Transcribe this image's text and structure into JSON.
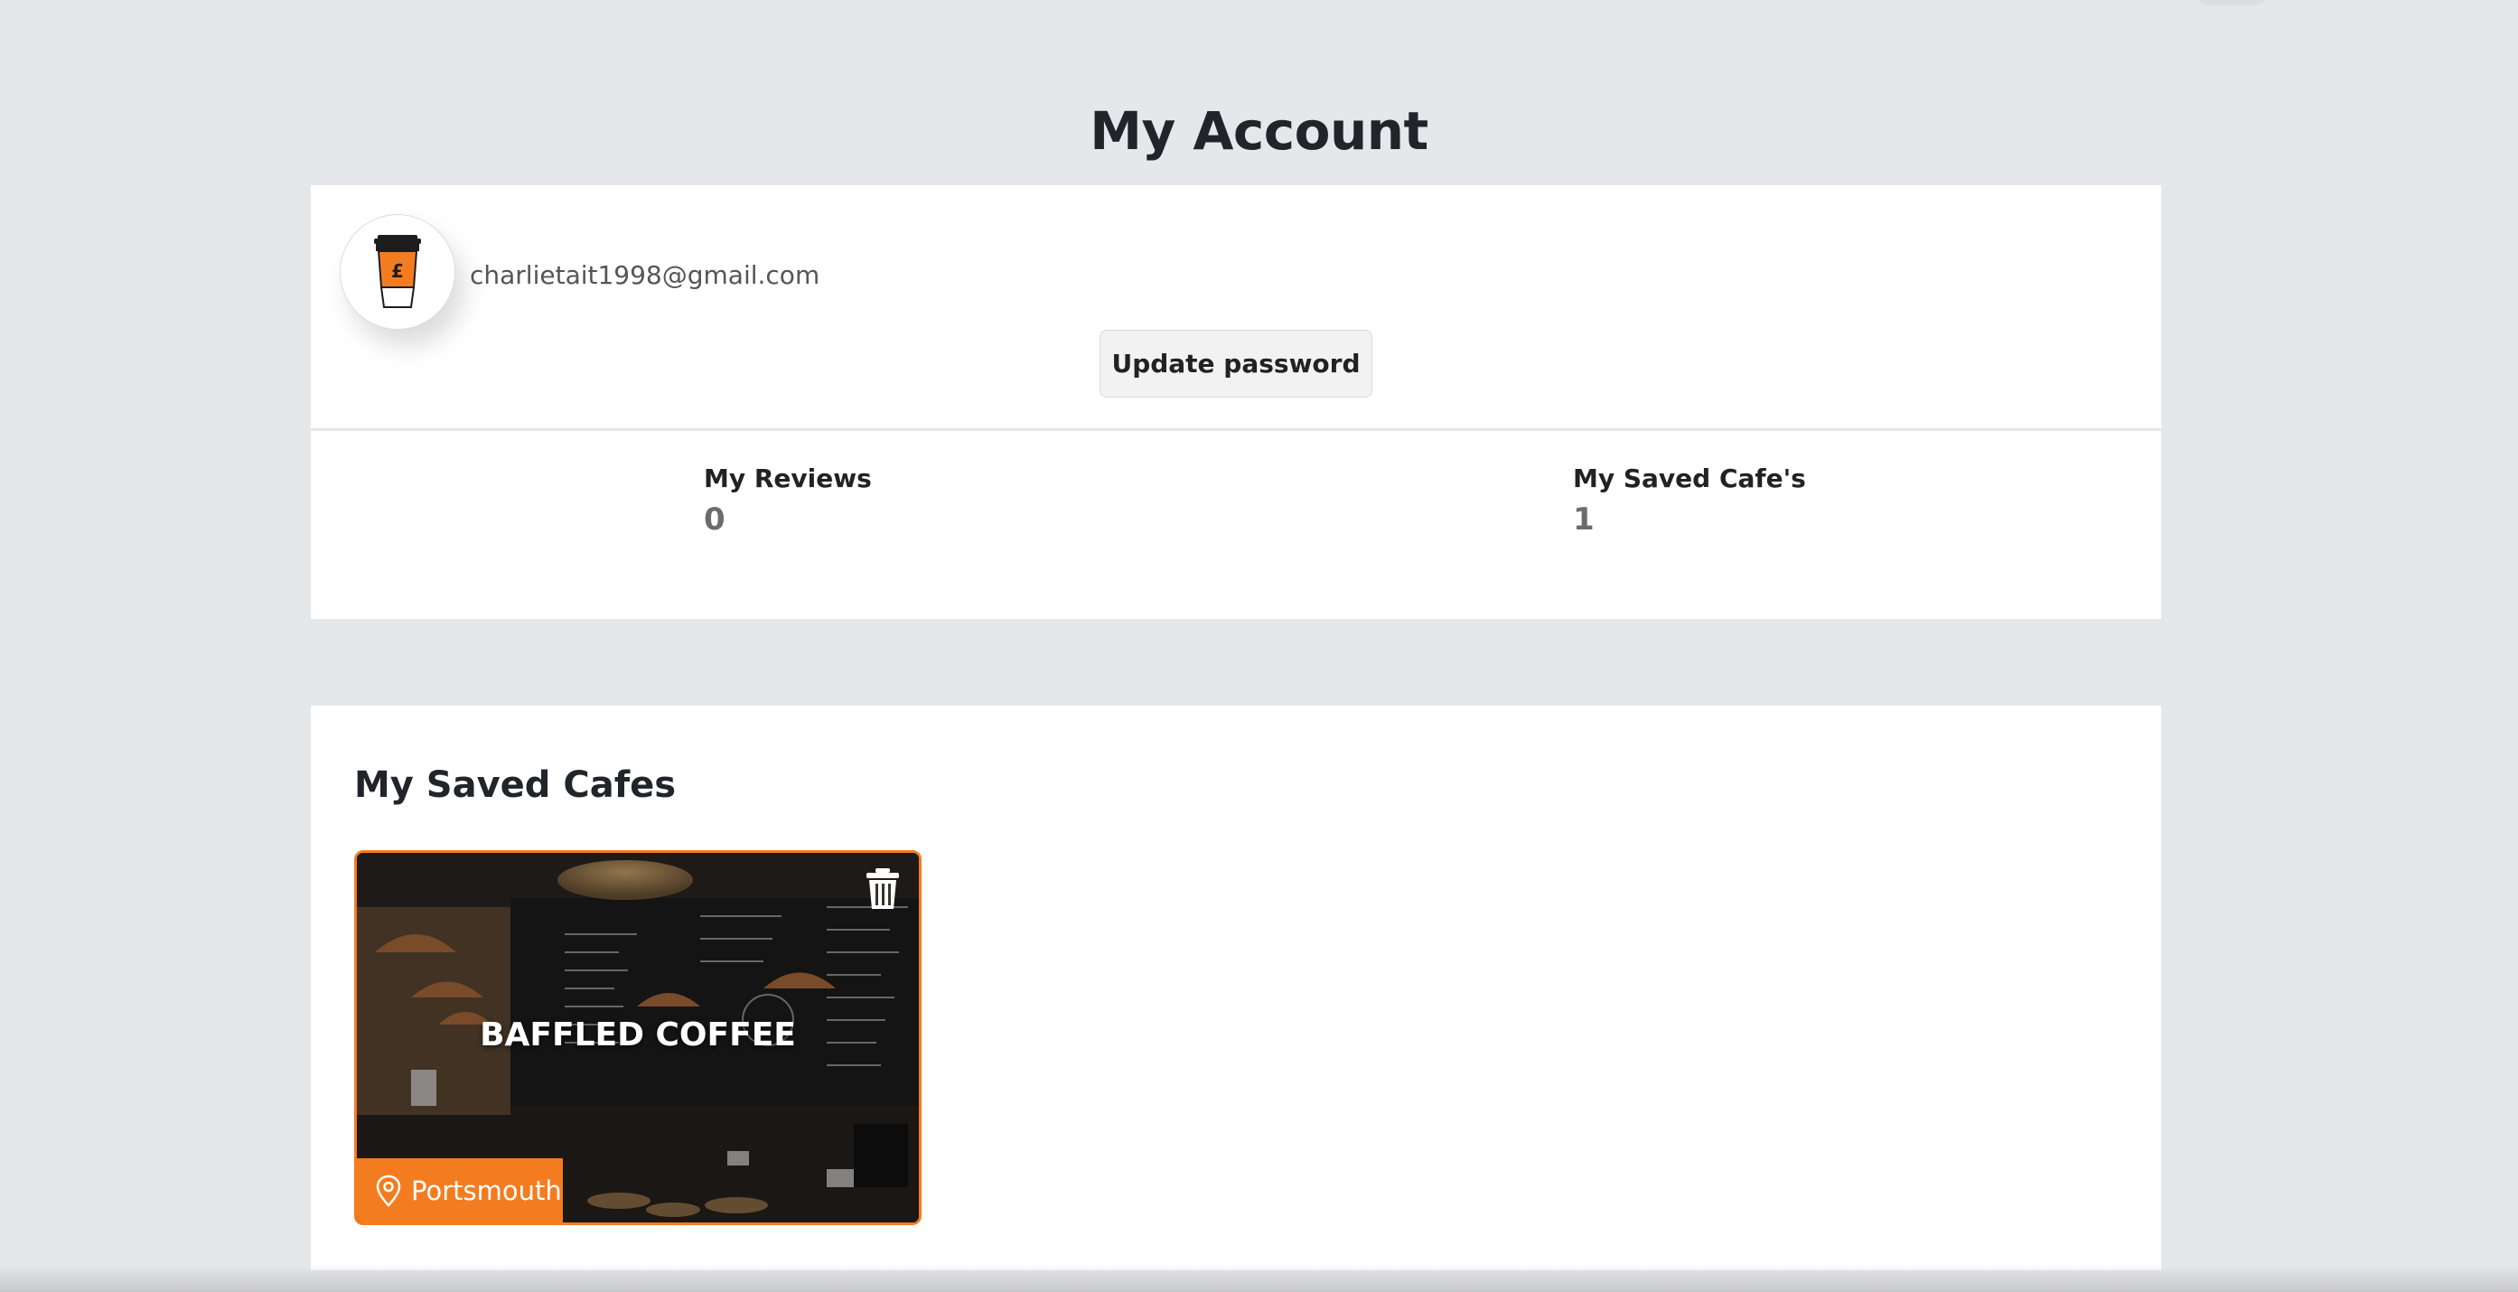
{
  "page": {
    "title": "My Account"
  },
  "account": {
    "email": "charlietait1998@gmail.com",
    "update_password_label": "Update password",
    "avatar_icon": "coffee-cup-pound-icon"
  },
  "stats": [
    {
      "label": "My Reviews",
      "value": "0"
    },
    {
      "label": "My Saved Cafe's",
      "value": "1"
    }
  ],
  "saved_cafes": {
    "title": "My Saved Cafes",
    "items": [
      {
        "name": "BAFFLED COFFEE",
        "location": "Portsmouth",
        "delete_icon": "trash-icon",
        "location_icon": "map-pin-icon"
      }
    ]
  },
  "colors": {
    "accent": "#f47c20",
    "background": "#e6e7eb",
    "card": "#ffffff",
    "text": "#212529",
    "muted": "#6c6c6c"
  }
}
